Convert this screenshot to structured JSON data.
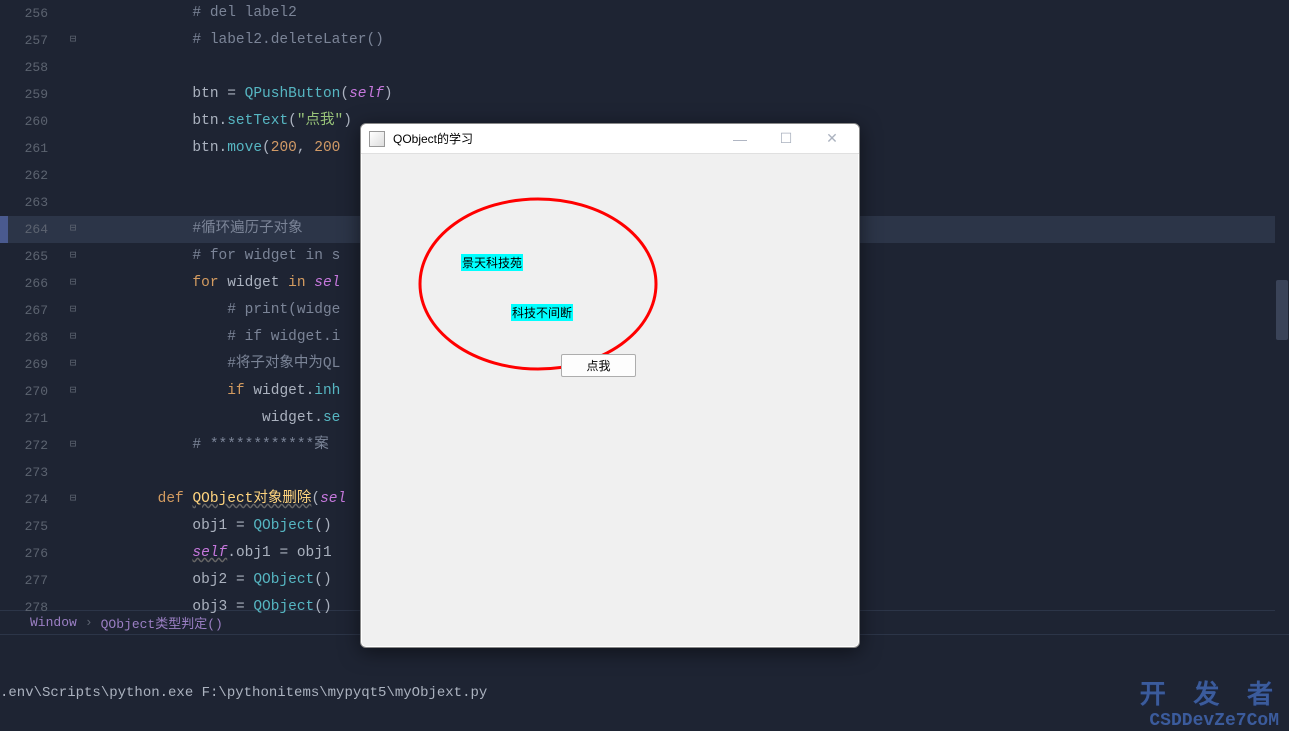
{
  "lines": [
    {
      "n": "256",
      "fold": "",
      "ind": "            ",
      "tokens": [
        {
          "c": "c-comment",
          "t": "# del label2"
        }
      ]
    },
    {
      "n": "257",
      "fold": "⊟",
      "ind": "            ",
      "tokens": [
        {
          "c": "c-comment",
          "t": "# label2.deleteLater()"
        }
      ]
    },
    {
      "n": "258",
      "fold": "",
      "ind": "",
      "tokens": []
    },
    {
      "n": "259",
      "fold": "",
      "ind": "            ",
      "tokens": [
        {
          "c": "c-id",
          "t": "btn "
        },
        {
          "c": "c-op",
          "t": "= "
        },
        {
          "c": "c-class",
          "t": "QPushButton"
        },
        {
          "c": "c-op",
          "t": "("
        },
        {
          "c": "c-self",
          "t": "self"
        },
        {
          "c": "c-op",
          "t": ")"
        }
      ]
    },
    {
      "n": "260",
      "fold": "",
      "ind": "            ",
      "tokens": [
        {
          "c": "c-id",
          "t": "btn"
        },
        {
          "c": "c-op",
          "t": "."
        },
        {
          "c": "c-method",
          "t": "setText"
        },
        {
          "c": "c-op",
          "t": "("
        },
        {
          "c": "c-str",
          "t": "\"点我\""
        },
        {
          "c": "c-op",
          "t": ")"
        }
      ]
    },
    {
      "n": "261",
      "fold": "",
      "ind": "            ",
      "tokens": [
        {
          "c": "c-id",
          "t": "btn"
        },
        {
          "c": "c-op",
          "t": "."
        },
        {
          "c": "c-method",
          "t": "move"
        },
        {
          "c": "c-op",
          "t": "("
        },
        {
          "c": "c-num",
          "t": "200"
        },
        {
          "c": "c-op",
          "t": ", "
        },
        {
          "c": "c-num",
          "t": "200"
        }
      ]
    },
    {
      "n": "262",
      "fold": "",
      "ind": "",
      "tokens": []
    },
    {
      "n": "263",
      "fold": "",
      "ind": "",
      "tokens": []
    },
    {
      "n": "264",
      "fold": "⊟",
      "ind": "            ",
      "tokens": [
        {
          "c": "c-comment",
          "t": "#循环遍历子对象"
        }
      ],
      "hl": true,
      "mark": true
    },
    {
      "n": "265",
      "fold": "⊟",
      "ind": "            ",
      "tokens": [
        {
          "c": "c-comment",
          "t": "# for widget in s"
        }
      ]
    },
    {
      "n": "266",
      "fold": "⊟",
      "ind": "            ",
      "tokens": [
        {
          "c": "c-key",
          "t": "for "
        },
        {
          "c": "c-id",
          "t": "widget "
        },
        {
          "c": "c-key",
          "t": "in "
        },
        {
          "c": "c-self",
          "t": "sel"
        }
      ]
    },
    {
      "n": "267",
      "fold": "⊟",
      "ind": "                ",
      "tokens": [
        {
          "c": "c-comment",
          "t": "# print(widge"
        }
      ]
    },
    {
      "n": "268",
      "fold": "⊟",
      "ind": "                ",
      "tokens": [
        {
          "c": "c-comment",
          "t": "# if widget.i"
        }
      ]
    },
    {
      "n": "269",
      "fold": "⊟",
      "ind": "                ",
      "tokens": [
        {
          "c": "c-comment",
          "t": "#将子对象中为QL"
        }
      ]
    },
    {
      "n": "270",
      "fold": "⊟",
      "ind": "                ",
      "tokens": [
        {
          "c": "c-key",
          "t": "if "
        },
        {
          "c": "c-id",
          "t": "widget"
        },
        {
          "c": "c-op",
          "t": "."
        },
        {
          "c": "c-method",
          "t": "inh"
        }
      ]
    },
    {
      "n": "271",
      "fold": "",
      "ind": "                    ",
      "tokens": [
        {
          "c": "c-id",
          "t": "widget"
        },
        {
          "c": "c-op",
          "t": "."
        },
        {
          "c": "c-method",
          "t": "se"
        }
      ]
    },
    {
      "n": "272",
      "fold": "⊟",
      "ind": "            ",
      "tokens": [
        {
          "c": "c-comment",
          "t": "# ************案"
        }
      ]
    },
    {
      "n": "273",
      "fold": "",
      "ind": "",
      "tokens": []
    },
    {
      "n": "274",
      "fold": "⊟",
      "ind": "        ",
      "tokens": [
        {
          "c": "c-key",
          "t": "def "
        },
        {
          "c": "c-func underline",
          "t": "QObject对象删除"
        },
        {
          "c": "c-op",
          "t": "("
        },
        {
          "c": "c-self",
          "t": "sel"
        }
      ]
    },
    {
      "n": "275",
      "fold": "",
      "ind": "            ",
      "tokens": [
        {
          "c": "c-id",
          "t": "obj1 "
        },
        {
          "c": "c-op",
          "t": "= "
        },
        {
          "c": "c-class",
          "t": "QObject"
        },
        {
          "c": "c-op",
          "t": "()"
        }
      ]
    },
    {
      "n": "276",
      "fold": "",
      "ind": "            ",
      "tokens": [
        {
          "c": "c-self underline",
          "t": "self"
        },
        {
          "c": "c-op",
          "t": "."
        },
        {
          "c": "c-id",
          "t": "obj1 "
        },
        {
          "c": "c-op",
          "t": "= "
        },
        {
          "c": "c-id",
          "t": "obj1"
        }
      ]
    },
    {
      "n": "277",
      "fold": "",
      "ind": "            ",
      "tokens": [
        {
          "c": "c-id",
          "t": "obj2 "
        },
        {
          "c": "c-op",
          "t": "= "
        },
        {
          "c": "c-class",
          "t": "QObject"
        },
        {
          "c": "c-op",
          "t": "()"
        }
      ]
    },
    {
      "n": "278",
      "fold": "",
      "ind": "            ",
      "tokens": [
        {
          "c": "c-id",
          "t": "obj3 "
        },
        {
          "c": "c-op",
          "t": "= "
        },
        {
          "c": "c-class",
          "t": "QObject"
        },
        {
          "c": "c-op",
          "t": "()"
        }
      ]
    }
  ],
  "breadcrumb": {
    "a": "Window",
    "sep": "›",
    "b": "QObject类型判定()"
  },
  "terminal": {
    "line": ".env\\Scripts\\python.exe F:\\pythonitems\\mypyqt5\\myObjext.py"
  },
  "watermark": {
    "a": "开 发 者",
    "b": "CSDDevZe7CoM"
  },
  "app": {
    "title": "QObject的学习",
    "label1": "景天科技苑",
    "label2": "科技不间断",
    "button": "点我",
    "min": "—",
    "max": "☐",
    "close": "✕"
  }
}
